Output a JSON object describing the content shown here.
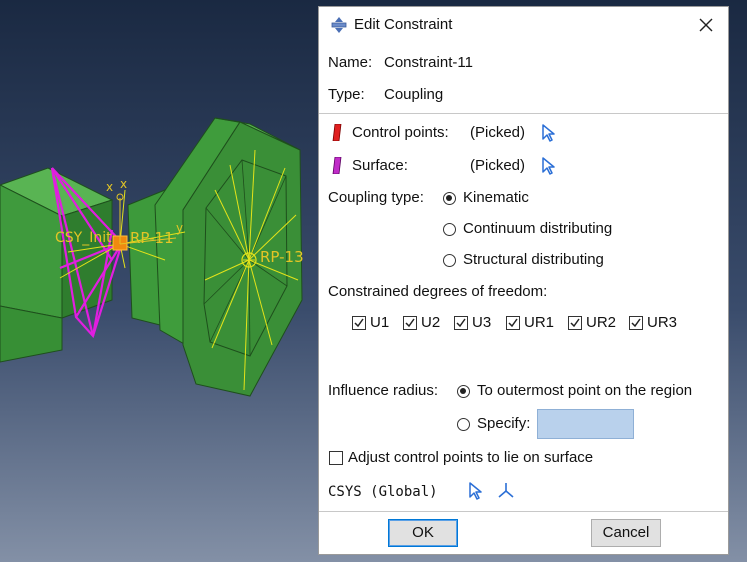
{
  "viewport": {
    "labels": {
      "rp11": "RP-11",
      "rp13": "RP-13",
      "csys": "CSY_Init",
      "x1": "x",
      "x2": "x",
      "y1": "y"
    }
  },
  "dialog": {
    "title": "Edit Constraint",
    "name_label": "Name:",
    "name_value": "Constraint-11",
    "type_label": "Type:",
    "type_value": "Coupling",
    "control_points_label": "Control points:",
    "control_points_value": "(Picked)",
    "surface_label": "Surface:",
    "surface_value": "(Picked)",
    "coupling_type_label": "Coupling type:",
    "coupling_options": [
      "Kinematic",
      "Continuum distributing",
      "Structural distributing"
    ],
    "coupling_selected": "Kinematic",
    "dof_label": "Constrained degrees of freedom:",
    "dof": [
      {
        "label": "U1",
        "checked": true
      },
      {
        "label": "U2",
        "checked": true
      },
      {
        "label": "U3",
        "checked": true
      },
      {
        "label": "UR1",
        "checked": true
      },
      {
        "label": "UR2",
        "checked": true
      },
      {
        "label": "UR3",
        "checked": true
      }
    ],
    "influence_label": "Influence radius:",
    "influence_options": [
      "To outermost point on the region",
      "Specify:"
    ],
    "influence_selected": "To outermost point on the region",
    "specify_value": "",
    "adjust_label": "Adjust control points to lie on surface",
    "adjust_checked": false,
    "csys_label": "CSYS (Global)",
    "ok_label": "OK",
    "cancel_label": "Cancel"
  },
  "colors": {
    "accent": "#0078d7",
    "control_point_marker": "#e02020",
    "surface_marker": "#c02cc8",
    "select_arrow": "#2b6fd6",
    "part_green": "#3f9a3d",
    "constraint_magenta": "#e11ee0",
    "label_yellow": "#e3c526"
  }
}
